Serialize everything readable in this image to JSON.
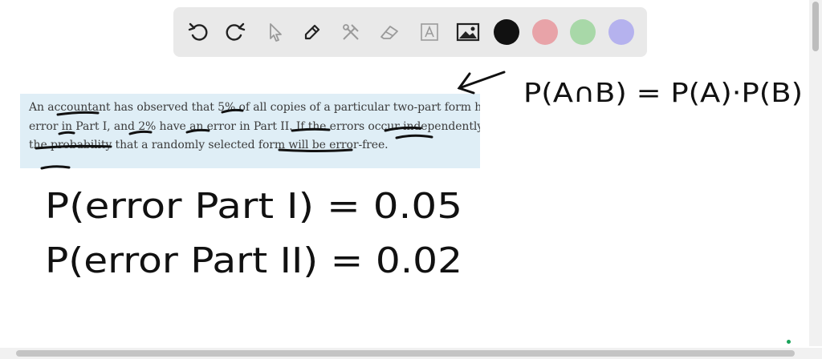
{
  "toolbar": {
    "tools": [
      {
        "name": "undo",
        "icon": "undo-icon"
      },
      {
        "name": "redo",
        "icon": "redo-icon"
      },
      {
        "name": "select",
        "icon": "cursor-icon"
      },
      {
        "name": "pen",
        "icon": "pen-icon"
      },
      {
        "name": "tools",
        "icon": "tools-icon"
      },
      {
        "name": "eraser",
        "icon": "eraser-icon"
      },
      {
        "name": "text",
        "icon": "text-box-icon"
      },
      {
        "name": "image",
        "icon": "image-icon"
      }
    ],
    "colors": {
      "black": "#111111",
      "red": "#e8a3a8",
      "green": "#a8d8a8",
      "purple": "#b5b2ee"
    }
  },
  "problem": {
    "text": "An accountant has observed that 5% of all copies of a particular two-part form have an error in Part I, and 2% have an error in Part II. If the errors occur independently, find the probability that a randomly selected form will be error-free."
  },
  "ink": {
    "formula": "P(A∩B) = P(A)·P(B)",
    "line1": "P(error Part I) = 0.05",
    "line2": "P(error Part II) = 0.02"
  },
  "colors": {
    "toolbar_bg": "#e9e9e9",
    "problem_bg": "#dfeef6",
    "ink": "#111111"
  }
}
